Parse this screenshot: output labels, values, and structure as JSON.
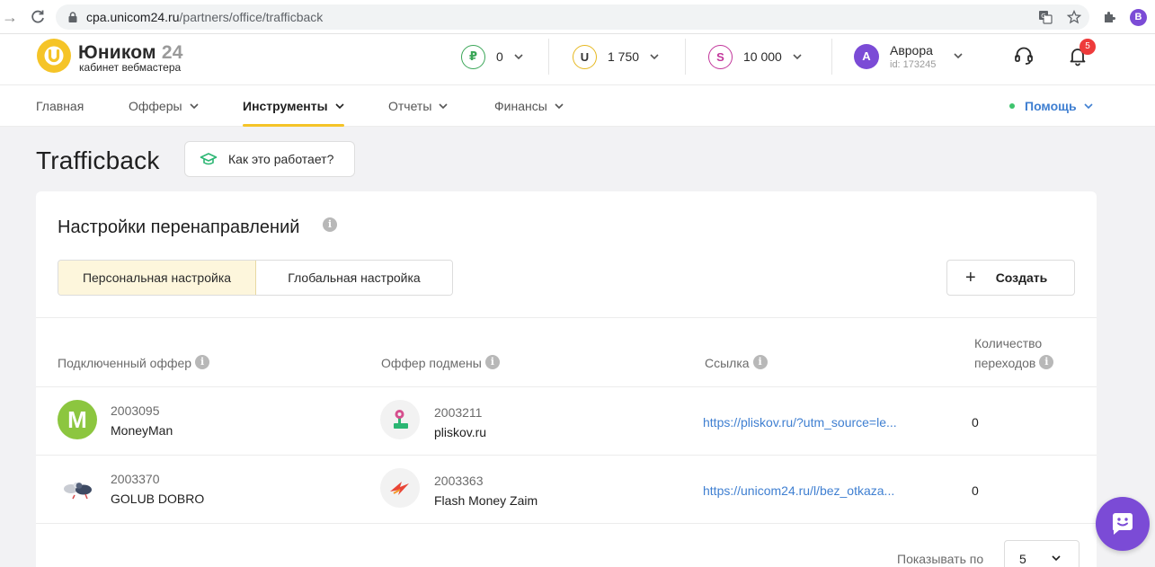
{
  "browser": {
    "url_host": "cpa.unicom24.ru",
    "url_path": "/partners/office/trafficback",
    "profile_initial": "B"
  },
  "header": {
    "logo_name": "Юником",
    "logo_num": "24",
    "logo_sub": "кабинет вебмастера",
    "balances": [
      {
        "symbol": "₽",
        "value": "0",
        "color": "#3aa657"
      },
      {
        "symbol": "U",
        "value": "1 750",
        "color": "#e6b820"
      },
      {
        "symbol": "S",
        "value": "10 000",
        "color": "#c2369b"
      }
    ],
    "user": {
      "initial": "А",
      "name": "Аврора",
      "id": "id: 173245"
    },
    "notifications_count": "5"
  },
  "nav": {
    "items": [
      {
        "label": "Главная",
        "dropdown": false,
        "active": false
      },
      {
        "label": "Офферы",
        "dropdown": true,
        "active": false
      },
      {
        "label": "Инструменты",
        "dropdown": true,
        "active": true
      },
      {
        "label": "Отчеты",
        "dropdown": true,
        "active": false
      },
      {
        "label": "Финансы",
        "dropdown": true,
        "active": false
      }
    ],
    "help_label": "Помощь"
  },
  "page": {
    "title": "Trafficback",
    "how_label": "Как это работает?"
  },
  "card": {
    "title": "Настройки перенаправлений",
    "tabs": [
      "Персональная настройка",
      "Глобальная настройка"
    ],
    "active_tab": "Персональная настройка",
    "create_label": "Создать",
    "columns": {
      "connected": "Подключенный оффер",
      "replace": "Оффер подмены",
      "link": "Ссылка",
      "count_line1": "Количество",
      "count_line2": "переходов"
    },
    "rows": [
      {
        "connected_id": "2003095",
        "connected_name": "MoneyMan",
        "connected_icon": "moneyman-logo",
        "replace_id": "2003211",
        "replace_name": "pliskov.ru",
        "replace_icon": "pliskov-logo",
        "link": "https://pliskov.ru/?utm_source=le...",
        "count": "0"
      },
      {
        "connected_id": "2003370",
        "connected_name": "GOLUB DOBRO",
        "connected_icon": "golub-dobro-logo",
        "replace_id": "2003363",
        "replace_name": "Flash Money Zaim",
        "replace_icon": "flash-money-logo",
        "link": "https://unicom24.ru/l/bez_otkaza...",
        "count": "0"
      }
    ],
    "show_by_label": "Показывать по",
    "per_page": "5"
  },
  "colors": {
    "accent_yellow": "#f5c428",
    "link_blue": "#3f7fd1",
    "brand_purple": "#7b4bd6",
    "badge_red": "#ee3b3b"
  }
}
